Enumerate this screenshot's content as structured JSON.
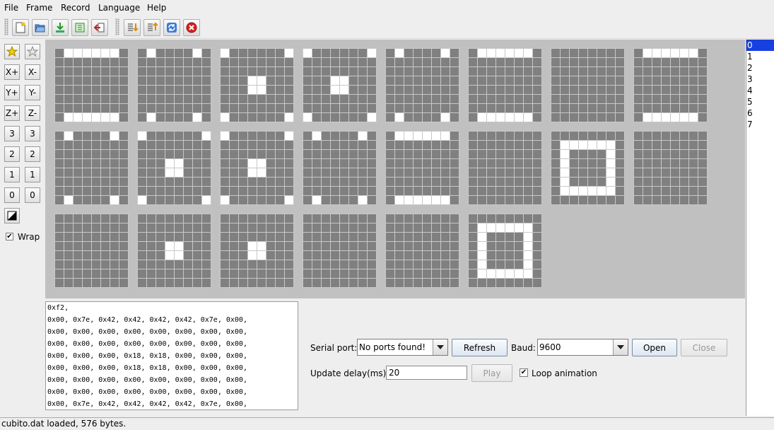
{
  "menu": [
    "File",
    "Frame",
    "Record",
    "Language",
    "Help"
  ],
  "toolbar": {
    "icons": [
      "new-file-icon",
      "open-folder-icon",
      "save-icon",
      "export-icon",
      "exit-icon",
      "import-icon",
      "edit-icon",
      "refresh-icon",
      "stop-icon"
    ]
  },
  "sidebar": {
    "buttons": [
      {
        "name": "light-all-button",
        "label": ""
      },
      {
        "name": "clear-all-button",
        "label": ""
      },
      {
        "name": "x-plus-button",
        "label": "X+"
      },
      {
        "name": "x-minus-button",
        "label": "X-"
      },
      {
        "name": "y-plus-button",
        "label": "Y+"
      },
      {
        "name": "y-minus-button",
        "label": "Y-"
      },
      {
        "name": "z-plus-button",
        "label": "Z+"
      },
      {
        "name": "z-minus-button",
        "label": "Z-"
      },
      {
        "name": "layer-3-down-button",
        "label": "3"
      },
      {
        "name": "layer-3-up-button",
        "label": "3"
      },
      {
        "name": "layer-2-down-button",
        "label": "2"
      },
      {
        "name": "layer-2-up-button",
        "label": "2"
      },
      {
        "name": "layer-1-down-button",
        "label": "1"
      },
      {
        "name": "layer-1-up-button",
        "label": "1"
      },
      {
        "name": "layer-0-down-button",
        "label": "0"
      },
      {
        "name": "layer-0-up-button",
        "label": "0"
      },
      {
        "name": "invert-button",
        "label": ""
      }
    ],
    "wrap_label": "Wrap",
    "wrap_checked": true
  },
  "layers": [
    {
      "on": [
        [
          1,
          0
        ],
        [
          2,
          0
        ],
        [
          3,
          0
        ],
        [
          4,
          0
        ],
        [
          5,
          0
        ],
        [
          6,
          0
        ],
        [
          1,
          7
        ],
        [
          2,
          7
        ],
        [
          3,
          7
        ],
        [
          4,
          7
        ],
        [
          5,
          7
        ],
        [
          6,
          7
        ]
      ]
    },
    {
      "on": [
        [
          1,
          0
        ],
        [
          6,
          0
        ],
        [
          1,
          7
        ],
        [
          6,
          7
        ]
      ]
    },
    {
      "on": [
        [
          0,
          0
        ],
        [
          7,
          0
        ],
        [
          3,
          3
        ],
        [
          4,
          3
        ],
        [
          3,
          4
        ],
        [
          4,
          4
        ],
        [
          0,
          7
        ],
        [
          7,
          7
        ]
      ]
    },
    {
      "on": [
        [
          0,
          0
        ],
        [
          7,
          0
        ],
        [
          3,
          3
        ],
        [
          4,
          3
        ],
        [
          3,
          4
        ],
        [
          4,
          4
        ],
        [
          0,
          7
        ],
        [
          7,
          7
        ]
      ]
    },
    {
      "on": [
        [
          1,
          0
        ],
        [
          6,
          0
        ],
        [
          1,
          7
        ],
        [
          6,
          7
        ]
      ]
    },
    {
      "on": [
        [
          1,
          0
        ],
        [
          2,
          0
        ],
        [
          3,
          0
        ],
        [
          4,
          0
        ],
        [
          5,
          0
        ],
        [
          6,
          0
        ],
        [
          1,
          7
        ],
        [
          2,
          7
        ],
        [
          3,
          7
        ],
        [
          4,
          7
        ],
        [
          5,
          7
        ],
        [
          6,
          7
        ]
      ]
    },
    {
      "on": []
    },
    {
      "on": [
        [
          1,
          0
        ],
        [
          2,
          0
        ],
        [
          3,
          0
        ],
        [
          4,
          0
        ],
        [
          5,
          0
        ],
        [
          6,
          0
        ],
        [
          1,
          7
        ],
        [
          2,
          7
        ],
        [
          3,
          7
        ],
        [
          4,
          7
        ],
        [
          5,
          7
        ],
        [
          6,
          7
        ]
      ]
    },
    {
      "on": [
        [
          1,
          0
        ],
        [
          6,
          0
        ],
        [
          1,
          7
        ],
        [
          6,
          7
        ]
      ]
    },
    {
      "on": [
        [
          0,
          0
        ],
        [
          7,
          0
        ],
        [
          3,
          3
        ],
        [
          4,
          3
        ],
        [
          3,
          4
        ],
        [
          4,
          4
        ],
        [
          0,
          7
        ],
        [
          7,
          7
        ]
      ]
    },
    {
      "on": [
        [
          0,
          0
        ],
        [
          7,
          0
        ],
        [
          3,
          3
        ],
        [
          4,
          3
        ],
        [
          3,
          4
        ],
        [
          4,
          4
        ],
        [
          0,
          7
        ],
        [
          7,
          7
        ]
      ]
    },
    {
      "on": [
        [
          1,
          0
        ],
        [
          6,
          0
        ],
        [
          1,
          7
        ],
        [
          6,
          7
        ]
      ]
    },
    {
      "on": [
        [
          1,
          0
        ],
        [
          2,
          0
        ],
        [
          3,
          0
        ],
        [
          4,
          0
        ],
        [
          5,
          0
        ],
        [
          6,
          0
        ],
        [
          1,
          7
        ],
        [
          2,
          7
        ],
        [
          3,
          7
        ],
        [
          4,
          7
        ],
        [
          5,
          7
        ],
        [
          6,
          7
        ]
      ]
    },
    {
      "on": []
    },
    {
      "on": [
        [
          1,
          1
        ],
        [
          2,
          1
        ],
        [
          3,
          1
        ],
        [
          4,
          1
        ],
        [
          5,
          1
        ],
        [
          6,
          1
        ],
        [
          1,
          2
        ],
        [
          6,
          2
        ],
        [
          1,
          3
        ],
        [
          6,
          3
        ],
        [
          1,
          4
        ],
        [
          6,
          4
        ],
        [
          1,
          5
        ],
        [
          6,
          5
        ],
        [
          1,
          6
        ],
        [
          2,
          6
        ],
        [
          3,
          6
        ],
        [
          4,
          6
        ],
        [
          5,
          6
        ],
        [
          6,
          6
        ]
      ]
    },
    {
      "on": []
    },
    {
      "on": []
    },
    {
      "on": [
        [
          3,
          3
        ],
        [
          4,
          3
        ],
        [
          3,
          4
        ],
        [
          4,
          4
        ]
      ]
    },
    {
      "on": [
        [
          3,
          3
        ],
        [
          4,
          3
        ],
        [
          3,
          4
        ],
        [
          4,
          4
        ]
      ]
    },
    {
      "on": []
    },
    {
      "on": []
    },
    {
      "on": [
        [
          1,
          1
        ],
        [
          2,
          1
        ],
        [
          3,
          1
        ],
        [
          4,
          1
        ],
        [
          5,
          1
        ],
        [
          6,
          1
        ],
        [
          1,
          2
        ],
        [
          6,
          2
        ],
        [
          1,
          3
        ],
        [
          6,
          3
        ],
        [
          1,
          4
        ],
        [
          6,
          4
        ],
        [
          1,
          5
        ],
        [
          6,
          5
        ],
        [
          1,
          6
        ],
        [
          2,
          6
        ],
        [
          3,
          6
        ],
        [
          4,
          6
        ],
        [
          5,
          6
        ],
        [
          6,
          6
        ]
      ]
    }
  ],
  "code_lines": [
    "0xf2,",
    "0x00, 0x7e, 0x42, 0x42, 0x42, 0x42, 0x7e, 0x00,",
    "0x00, 0x00, 0x00, 0x00, 0x00, 0x00, 0x00, 0x00,",
    "0x00, 0x00, 0x00, 0x00, 0x00, 0x00, 0x00, 0x00,",
    "0x00, 0x00, 0x00, 0x18, 0x18, 0x00, 0x00, 0x00,",
    "0x00, 0x00, 0x00, 0x18, 0x18, 0x00, 0x00, 0x00,",
    "0x00, 0x00, 0x00, 0x00, 0x00, 0x00, 0x00, 0x00,",
    "0x00, 0x00, 0x00, 0x00, 0x00, 0x00, 0x00, 0x00,",
    "0x00, 0x7e, 0x42, 0x42, 0x42, 0x42, 0x7e, 0x00,"
  ],
  "serial": {
    "port_label": "Serial port:",
    "port_value": "No ports found!",
    "refresh_label": "Refresh",
    "baud_label": "Baud:",
    "baud_value": "9600",
    "open_label": "Open",
    "close_label": "Close"
  },
  "update": {
    "label": "Update delay(ms):",
    "value": "20",
    "play_label": "Play",
    "loop_label": "Loop animation",
    "loop_checked": true
  },
  "frames": {
    "items": [
      "0",
      "1",
      "2",
      "3",
      "4",
      "5",
      "6",
      "7"
    ],
    "selected": 0
  },
  "status": "cubito.dat loaded, 576 bytes.",
  "colors": {
    "led_off": "#808080",
    "led_on": "#ffffff",
    "grid_line": "#c8c8c8",
    "selection": "#1640e0"
  }
}
